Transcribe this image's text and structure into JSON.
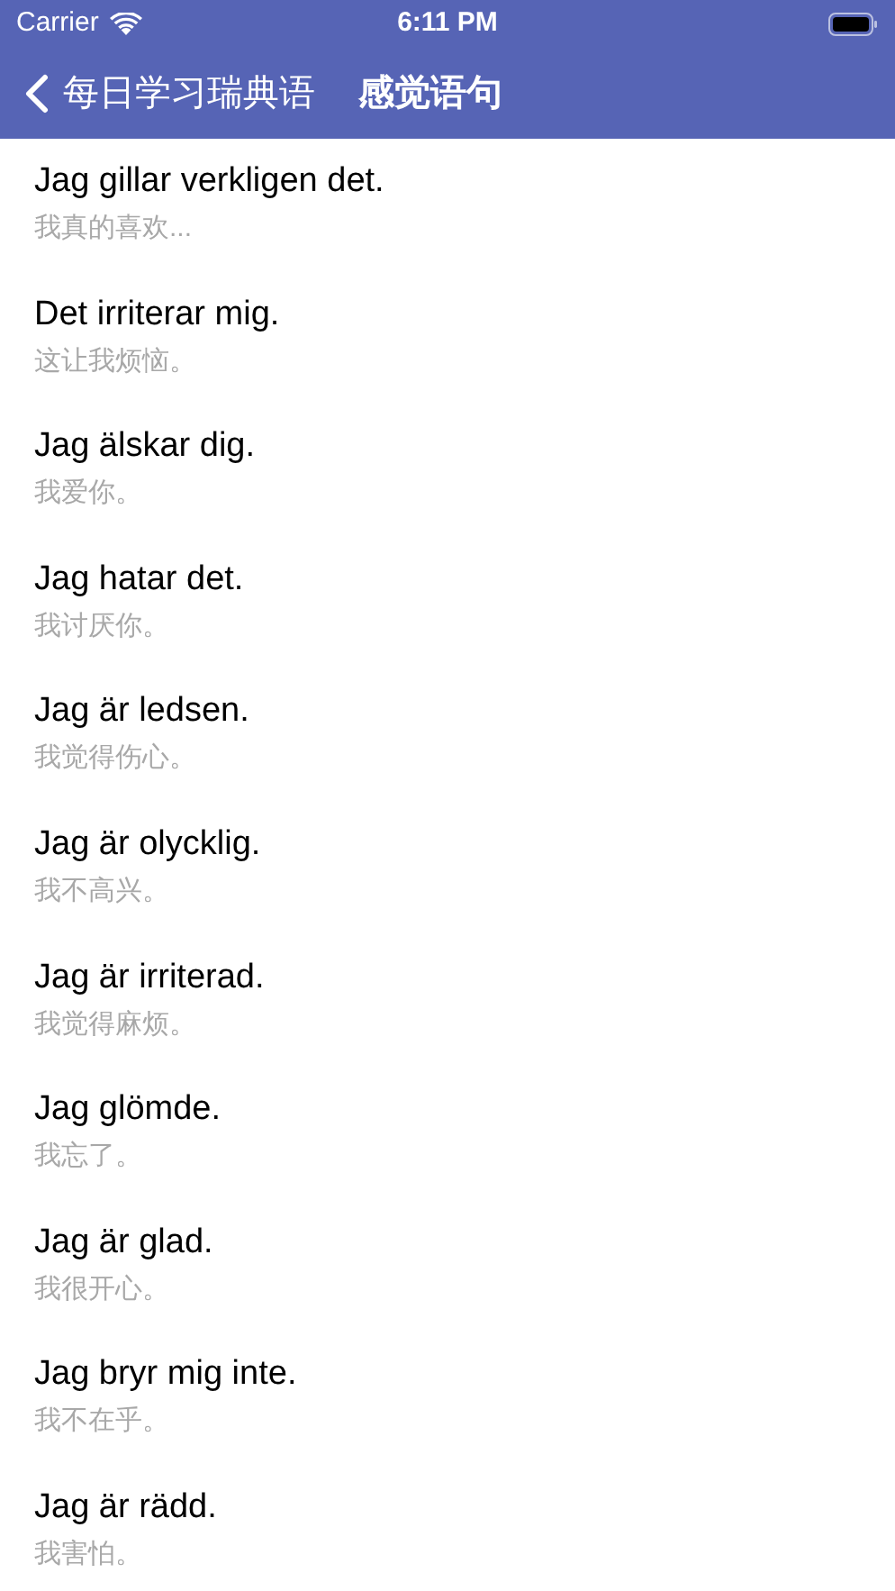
{
  "status_bar": {
    "carrier": "Carrier",
    "time": "6:11 PM"
  },
  "nav_bar": {
    "back_label": "每日学习瑞典语",
    "title": "感觉语句"
  },
  "phrases": [
    {
      "text": "Jag gillar verkligen det.",
      "translation": "我真的喜欢..."
    },
    {
      "text": "Det irriterar mig.",
      "translation": "这让我烦恼。"
    },
    {
      "text": "Jag älskar dig.",
      "translation": "我爱你。"
    },
    {
      "text": "Jag hatar det.",
      "translation": "我讨厌你。"
    },
    {
      "text": "Jag är ledsen.",
      "translation": "我觉得伤心。"
    },
    {
      "text": "Jag är olycklig.",
      "translation": "我不高兴。"
    },
    {
      "text": "Jag är irriterad.",
      "translation": "我觉得麻烦。"
    },
    {
      "text": "Jag glömde.",
      "translation": "我忘了。"
    },
    {
      "text": "Jag är glad.",
      "translation": "我很开心。"
    },
    {
      "text": "Jag bryr mig inte.",
      "translation": "我不在乎。"
    },
    {
      "text": "Jag är rädd.",
      "translation": "我害怕。"
    }
  ]
}
